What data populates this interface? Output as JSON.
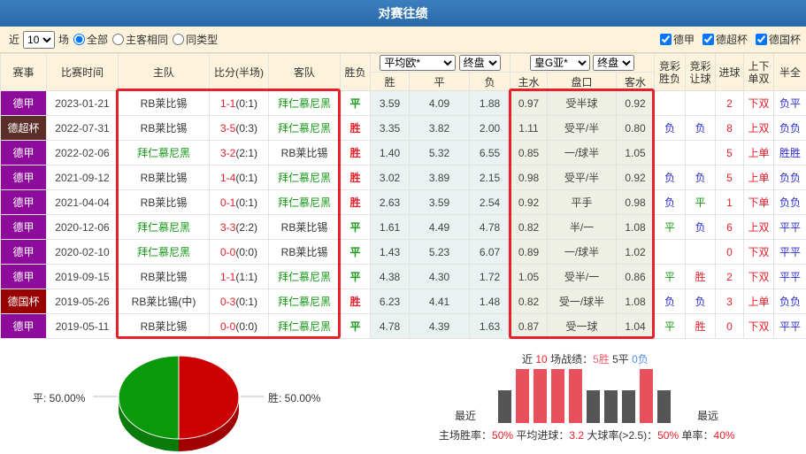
{
  "title": "对赛往绩",
  "filter": {
    "prefix": "近",
    "count": "10",
    "suffix": "场",
    "radios": [
      "全部",
      "主客相同",
      "同类型"
    ],
    "selected_radio": 0,
    "checks": [
      "德甲",
      "德超杯",
      "德国杯"
    ]
  },
  "headers": {
    "league": "赛事",
    "date": "比赛时间",
    "home": "主队",
    "score": "比分(半场)",
    "away": "客队",
    "result": "胜负",
    "euro_select": "平均欧*",
    "euro_stage": "终盘",
    "win": "胜",
    "draw": "平",
    "lose": "负",
    "asia_select": "皇G亚*",
    "asia_stage": "终盘",
    "home_water": "主水",
    "handicap": "盘口",
    "away_water": "客水",
    "jc_result": "竞彩胜负",
    "jc_handicap": "竞彩让球",
    "goals": "进球",
    "ou": "上下单双",
    "htft": "半全"
  },
  "colors": {
    "德甲": "#8e0c9c",
    "德超杯": "#5c2e2a",
    "德国杯": "#990000"
  },
  "rows": [
    {
      "league": "德甲",
      "date": "2023-01-21",
      "home": "RB莱比锡",
      "home_g": false,
      "score": "1-1",
      "half": "(0:1)",
      "away": "拜仁慕尼黑",
      "away_g": true,
      "res": "平",
      "w": "3.59",
      "d": "4.09",
      "l": "1.88",
      "hw": "0.97",
      "hc": "受半球",
      "aw": "0.92",
      "jc1": "",
      "jc2": "",
      "goals": "2",
      "ou": "下双",
      "htft": "负平"
    },
    {
      "league": "德超杯",
      "date": "2022-07-31",
      "home": "RB莱比锡",
      "home_g": false,
      "score": "3-5",
      "half": "(0:3)",
      "away": "拜仁慕尼黑",
      "away_g": true,
      "res": "胜",
      "w": "3.35",
      "d": "3.82",
      "l": "2.00",
      "hw": "1.11",
      "hc": "受平/半",
      "aw": "0.80",
      "jc1": "负",
      "jc2": "负",
      "goals": "8",
      "ou": "上双",
      "htft": "负负"
    },
    {
      "league": "德甲",
      "date": "2022-02-06",
      "home": "拜仁慕尼黑",
      "home_g": true,
      "score": "3-2",
      "half": "(2:1)",
      "away": "RB莱比锡",
      "away_g": false,
      "res": "胜",
      "w": "1.40",
      "d": "5.32",
      "l": "6.55",
      "hw": "0.85",
      "hc": "一/球半",
      "aw": "1.05",
      "jc1": "",
      "jc2": "",
      "goals": "5",
      "ou": "上单",
      "htft": "胜胜"
    },
    {
      "league": "德甲",
      "date": "2021-09-12",
      "home": "RB莱比锡",
      "home_g": false,
      "score": "1-4",
      "half": "(0:1)",
      "away": "拜仁慕尼黑",
      "away_g": true,
      "res": "胜",
      "w": "3.02",
      "d": "3.89",
      "l": "2.15",
      "hw": "0.98",
      "hc": "受平/半",
      "aw": "0.92",
      "jc1": "负",
      "jc2": "负",
      "goals": "5",
      "ou": "上单",
      "htft": "负负"
    },
    {
      "league": "德甲",
      "date": "2021-04-04",
      "home": "RB莱比锡",
      "home_g": false,
      "score": "0-1",
      "half": "(0:1)",
      "away": "拜仁慕尼黑",
      "away_g": true,
      "res": "胜",
      "w": "2.63",
      "d": "3.59",
      "l": "2.54",
      "hw": "0.92",
      "hc": "平手",
      "aw": "0.98",
      "jc1": "负",
      "jc2": "平",
      "goals": "1",
      "ou": "下单",
      "htft": "负负"
    },
    {
      "league": "德甲",
      "date": "2020-12-06",
      "home": "拜仁慕尼黑",
      "home_g": true,
      "score": "3-3",
      "half": "(2:2)",
      "away": "RB莱比锡",
      "away_g": false,
      "res": "平",
      "w": "1.61",
      "d": "4.49",
      "l": "4.78",
      "hw": "0.82",
      "hc": "半/一",
      "aw": "1.08",
      "jc1": "平",
      "jc2": "负",
      "goals": "6",
      "ou": "上双",
      "htft": "平平"
    },
    {
      "league": "德甲",
      "date": "2020-02-10",
      "home": "拜仁慕尼黑",
      "home_g": true,
      "score": "0-0",
      "half": "(0:0)",
      "away": "RB莱比锡",
      "away_g": false,
      "res": "平",
      "w": "1.43",
      "d": "5.23",
      "l": "6.07",
      "hw": "0.89",
      "hc": "一/球半",
      "aw": "1.02",
      "jc1": "",
      "jc2": "",
      "goals": "0",
      "ou": "下双",
      "htft": "平平"
    },
    {
      "league": "德甲",
      "date": "2019-09-15",
      "home": "RB莱比锡",
      "home_g": false,
      "score": "1-1",
      "half": "(1:1)",
      "away": "拜仁慕尼黑",
      "away_g": true,
      "res": "平",
      "w": "4.38",
      "d": "4.30",
      "l": "1.72",
      "hw": "1.05",
      "hc": "受半/一",
      "aw": "0.86",
      "jc1": "平",
      "jc2": "胜",
      "goals": "2",
      "ou": "下双",
      "htft": "平平"
    },
    {
      "league": "德国杯",
      "date": "2019-05-26",
      "home": "RB莱比锡(中)",
      "home_g": false,
      "score": "0-3",
      "half": "(0:1)",
      "away": "拜仁慕尼黑",
      "away_g": true,
      "res": "胜",
      "w": "6.23",
      "d": "4.41",
      "l": "1.48",
      "hw": "0.82",
      "hc": "受一/球半",
      "aw": "1.08",
      "jc1": "负",
      "jc2": "负",
      "goals": "3",
      "ou": "上单",
      "htft": "负负"
    },
    {
      "league": "德甲",
      "date": "2019-05-11",
      "home": "RB莱比锡",
      "home_g": false,
      "score": "0-0",
      "half": "(0:0)",
      "away": "拜仁慕尼黑",
      "away_g": true,
      "res": "平",
      "w": "4.78",
      "d": "4.39",
      "l": "1.63",
      "hw": "0.87",
      "hc": "受一球",
      "aw": "1.04",
      "jc1": "平",
      "jc2": "胜",
      "goals": "0",
      "ou": "下双",
      "htft": "平平"
    }
  ],
  "pie": {
    "draw_label": "平: 50.00%",
    "win_label": "胜: 50.00%",
    "draw": 50,
    "win": 50
  },
  "summary": {
    "p1": "近",
    "n": "10",
    "p2": "场战绩：",
    "wins": "5胜",
    "draws": "5平",
    "losses": "0负",
    "recent": "最近",
    "far": "最远",
    "stats": [
      {
        "k": "主场胜率：",
        "v": "50%"
      },
      {
        "k": "平均进球：",
        "v": "3.2"
      },
      {
        "k": "大球率(>2.5)：",
        "v": "50%"
      },
      {
        "k": "单率：",
        "v": "40%"
      }
    ]
  }
}
